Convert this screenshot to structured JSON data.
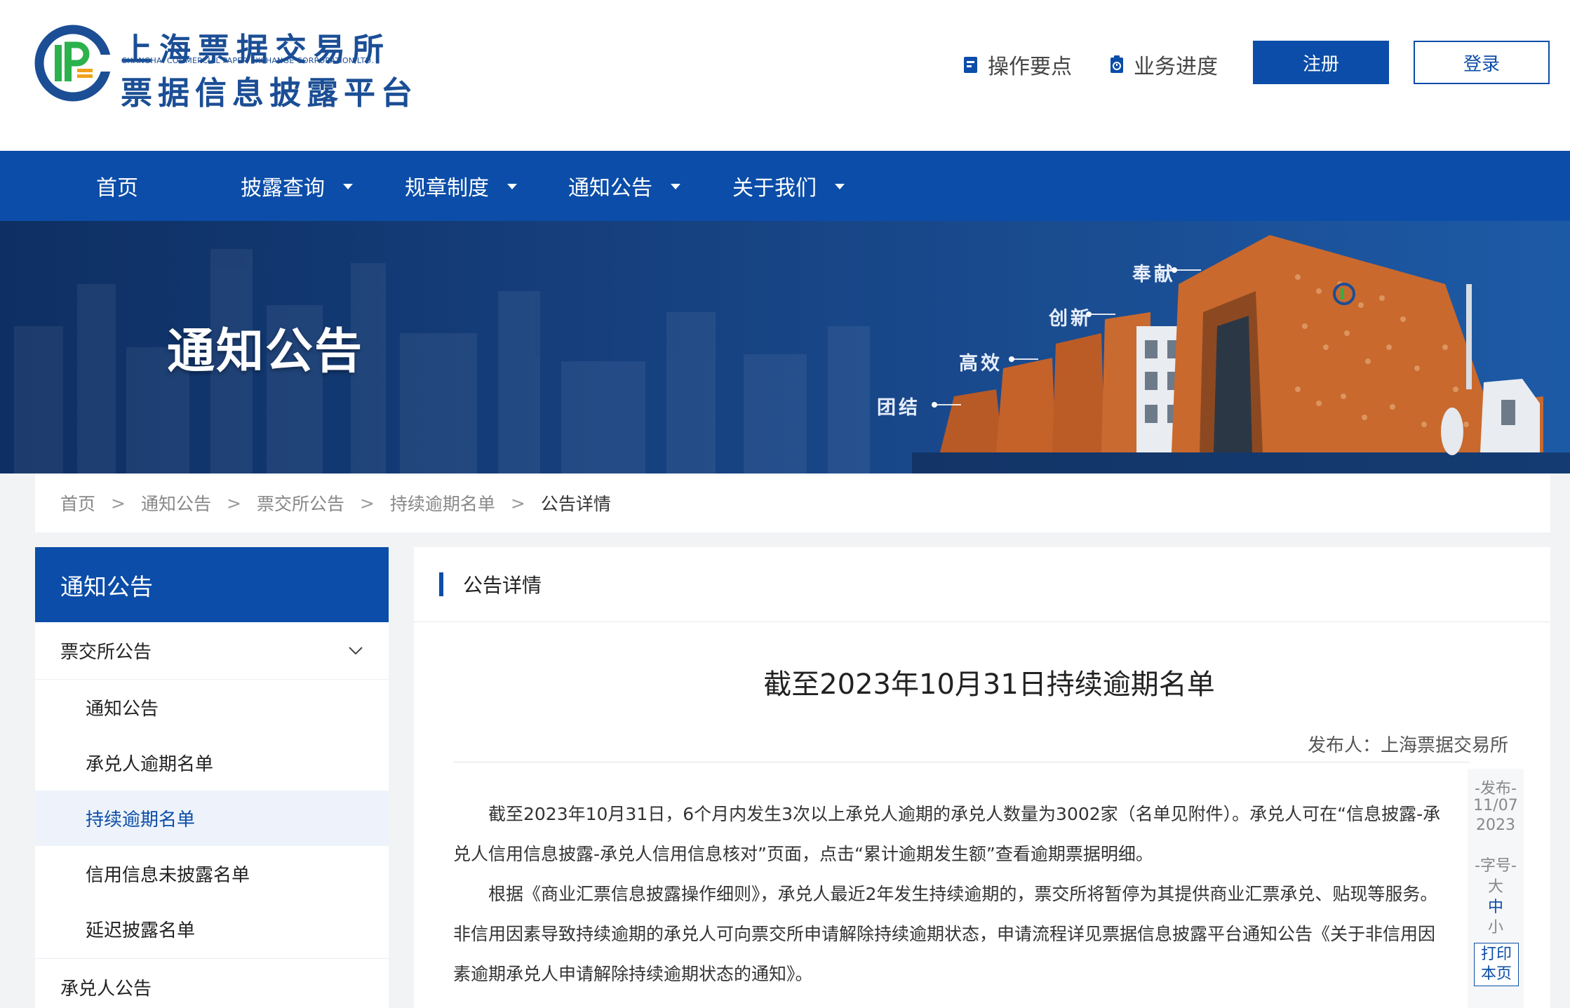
{
  "header": {
    "logo_cn_line1": "上海票据交易所",
    "logo_en": "SHANGHAI COMMERCIAL PAPER EXCHANGE CORPORATION LTD.",
    "logo_cn_line2": "票据信息披露平台",
    "links": [
      {
        "label": "操作要点",
        "icon": "guide-icon"
      },
      {
        "label": "业务进度",
        "icon": "progress-icon"
      }
    ],
    "register_label": "注册",
    "login_label": "登录"
  },
  "nav": {
    "items": [
      {
        "label": "首页"
      },
      {
        "label": "披露查询"
      },
      {
        "label": "规章制度"
      },
      {
        "label": "通知公告"
      },
      {
        "label": "关于我们"
      }
    ]
  },
  "banner": {
    "title": "通知公告",
    "words": [
      "团结",
      "高效",
      "创新",
      "奉献"
    ]
  },
  "breadcrumb": {
    "items": [
      "首页",
      "通知公告",
      "票交所公告",
      "持续逾期名单",
      "公告详情"
    ],
    "separator": ">"
  },
  "sidebar": {
    "title": "通知公告",
    "group": "票交所公告",
    "items": [
      "通知公告",
      "承兑人逾期名单",
      "持续逾期名单",
      "信用信息未披露名单",
      "延迟披露名单"
    ],
    "group2": "承兑人公告"
  },
  "main": {
    "section_title": "公告详情",
    "article_title": "截至2023年10月31日持续逾期名单",
    "publisher": "发布人：上海票据交易所",
    "paragraphs": [
      "截至2023年10月31日，6个月内发生3次以上承兑人逾期的承兑人数量为3002家（名单见附件）。承兑人可在“信息披露-承兑人信用信息披露-承兑人信用信息核对”页面，点击“累计逾期发生额”查看逾期票据明细。",
      "根据《商业汇票信息披露操作细则》，承兑人最近2年发生持续逾期的，票交所将暂停为其提供商业汇票承兑、贴现等服务。非信用因素导致持续逾期的承兑人可向票交所申请解除持续逾期状态，申请流程详见票据信息披露平台通知公告《关于非信用因素逾期承兑人申请解除持续逾期状态的通知》。"
    ],
    "tools": {
      "publish_label": "-发布-",
      "publish_date": "11/07",
      "publish_year": "2023",
      "font_label": "-字号-",
      "font_large": "大",
      "font_medium": "中",
      "font_small": "小",
      "print_line1": "打印",
      "print_line2": "本页"
    }
  },
  "colors": {
    "brand_blue": "#0b4da8",
    "logo_green": "#2bb24c",
    "building_orange": "#c4622a"
  }
}
